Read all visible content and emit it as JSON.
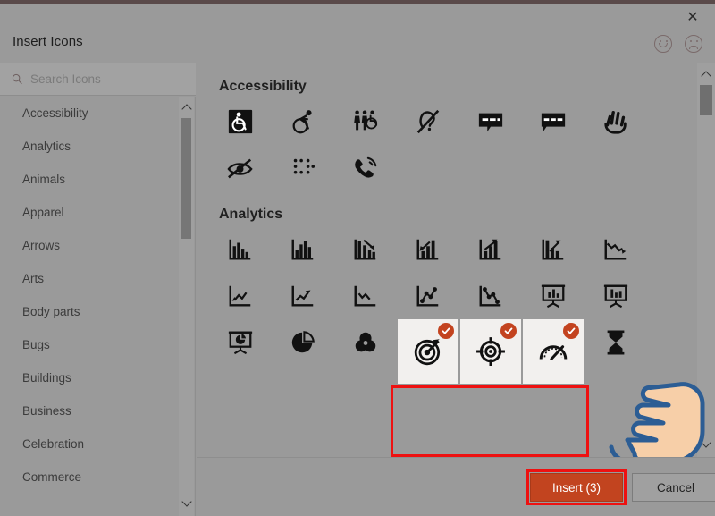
{
  "dialog": {
    "title": "Insert Icons",
    "close_label": "✕",
    "close_icon": "close-icon",
    "feedback_happy_icon": "smiley-face-icon",
    "feedback_sad_icon": "frowny-face-icon"
  },
  "search": {
    "placeholder": "Search Icons",
    "value": "",
    "icon": "search-icon"
  },
  "sidebar": {
    "categories": [
      {
        "label": "Accessibility"
      },
      {
        "label": "Analytics"
      },
      {
        "label": "Animals"
      },
      {
        "label": "Apparel"
      },
      {
        "label": "Arrows"
      },
      {
        "label": "Arts"
      },
      {
        "label": "Body parts"
      },
      {
        "label": "Bugs"
      },
      {
        "label": "Buildings"
      },
      {
        "label": "Business"
      },
      {
        "label": "Celebration"
      },
      {
        "label": "Commerce"
      }
    ],
    "scroll_up_icon": "chevron-up-icon",
    "scroll_down_icon": "chevron-down-icon"
  },
  "main": {
    "scroll_up_icon": "chevron-up-icon",
    "scroll_down_icon": "chevron-down-icon",
    "sections": [
      {
        "title": "Accessibility",
        "icons": [
          {
            "name": "wheelchair-sign-icon",
            "selected": false
          },
          {
            "name": "wheelchair-racing-icon",
            "selected": false
          },
          {
            "name": "accessible-restroom-group-icon",
            "selected": false
          },
          {
            "name": "deaf-ear-icon",
            "selected": false
          },
          {
            "name": "closed-caption-icon",
            "selected": false
          },
          {
            "name": "closed-caption-alt-icon",
            "selected": false
          },
          {
            "name": "sign-language-hand-icon",
            "selected": false
          },
          {
            "name": "eye-slash-icon",
            "selected": false
          },
          {
            "name": "braille-dots-icon",
            "selected": false
          },
          {
            "name": "phone-ringing-icon",
            "selected": false
          }
        ]
      },
      {
        "title": "Analytics",
        "icons": [
          {
            "name": "bar-chart-icon",
            "selected": false
          },
          {
            "name": "bar-chart-column-icon",
            "selected": false
          },
          {
            "name": "bar-chart-down-arrow-icon",
            "selected": false
          },
          {
            "name": "bar-chart-up-left-arrow-icon",
            "selected": false
          },
          {
            "name": "bar-chart-up-arrow-icon",
            "selected": false
          },
          {
            "name": "bar-chart-diagonal-arrow-icon",
            "selected": false
          },
          {
            "name": "line-chart-down-icon",
            "selected": false
          },
          {
            "name": "line-chart-zigzag-icon",
            "selected": false
          },
          {
            "name": "line-chart-up-arrow-icon",
            "selected": false
          },
          {
            "name": "line-chart-declining-icon",
            "selected": false
          },
          {
            "name": "scatter-line-up-icon",
            "selected": false
          },
          {
            "name": "scatter-line-down-icon",
            "selected": false
          },
          {
            "name": "presentation-bar-chart-icon",
            "selected": false
          },
          {
            "name": "presentation-chart-alt-icon",
            "selected": false
          },
          {
            "name": "presentation-pie-chart-icon",
            "selected": false
          },
          {
            "name": "pie-chart-icon",
            "selected": false
          },
          {
            "name": "venn-diagram-icon",
            "selected": false
          },
          {
            "name": "target-dart-icon",
            "selected": true
          },
          {
            "name": "crosshair-target-icon",
            "selected": true
          },
          {
            "name": "gauge-meter-icon",
            "selected": true
          },
          {
            "name": "hourglass-icon",
            "selected": false
          }
        ]
      }
    ]
  },
  "footer": {
    "insert_label": "Insert (3)",
    "cancel_label": "Cancel"
  },
  "annotations": {
    "selection_box_color": "#ee1111",
    "insert_box_color": "#ee1111",
    "cursor_icon": "pointing-hand-cursor"
  },
  "colors": {
    "accent": "#c2441f",
    "badge": "#c3431f",
    "dialog_bg": "#9a9a9a",
    "tile_bg": "#f2f0ee",
    "highlight": "#ee1111"
  }
}
